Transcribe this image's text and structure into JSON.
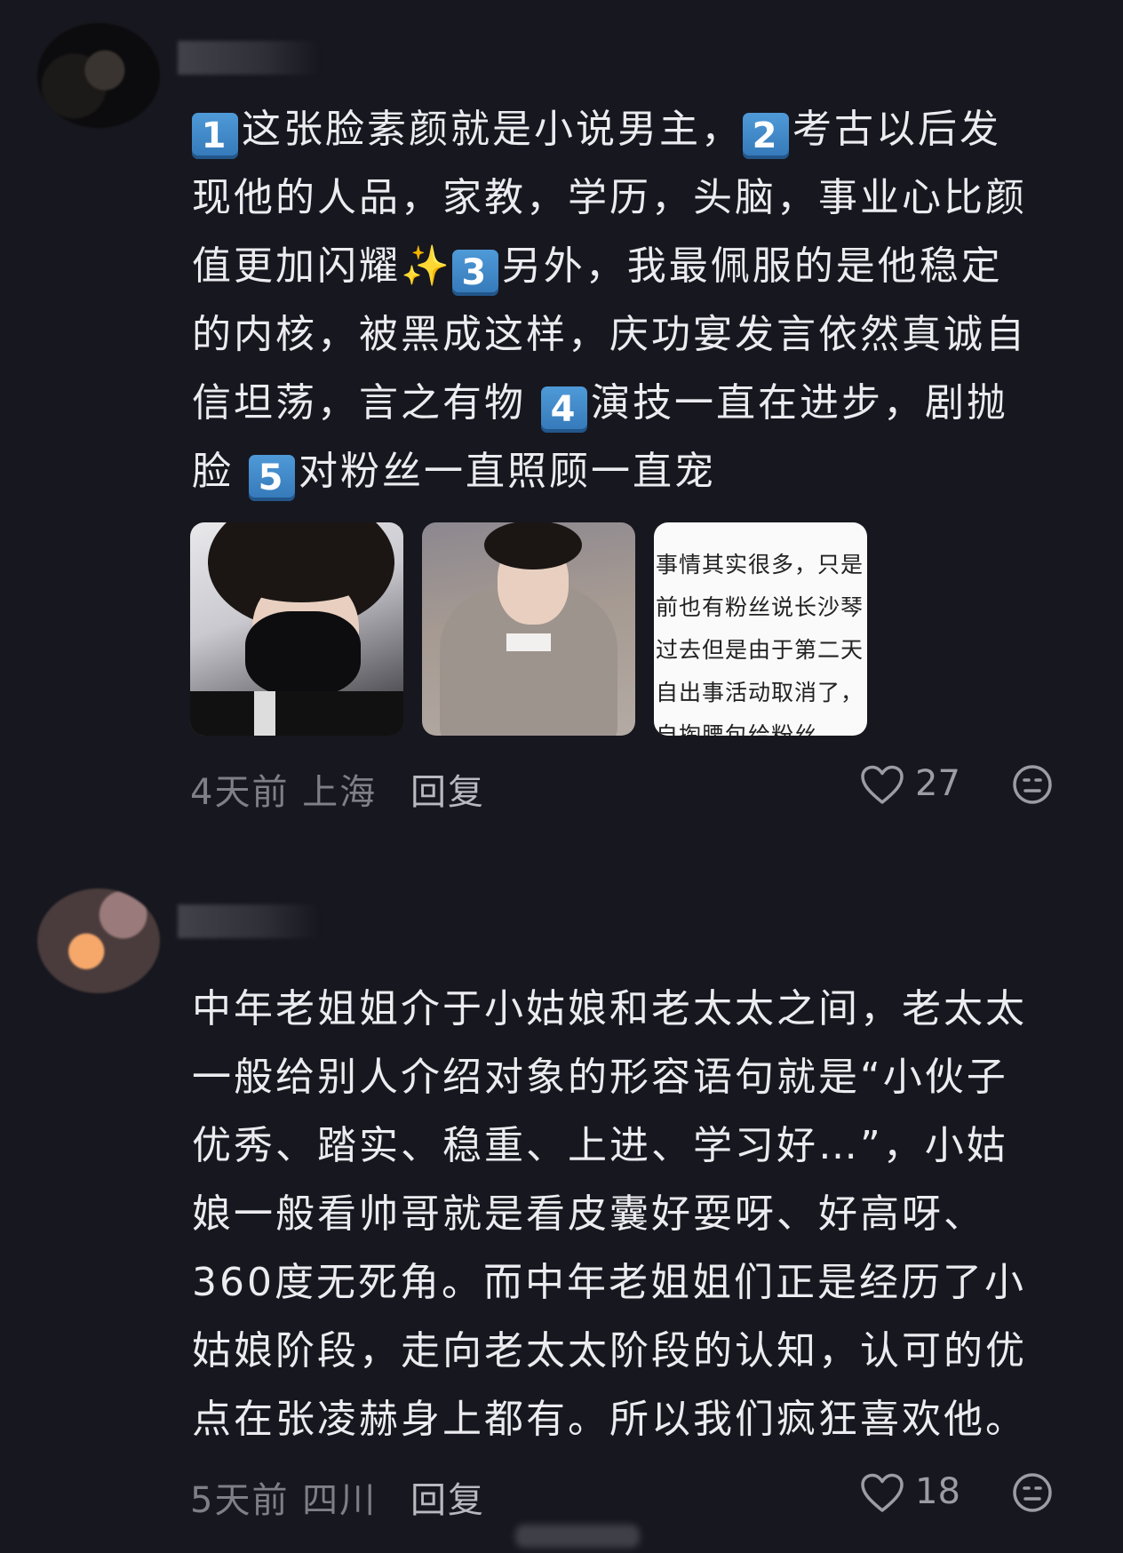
{
  "comments": [
    {
      "lines": [
        [
          {
            "k": "1"
          },
          "这张脸素颜就是小说男主，",
          {
            "k": "2"
          },
          "考古以后发"
        ],
        [
          "现他的人品，家教，学历，头脑，事业心比颜"
        ],
        [
          "值更加闪耀",
          {
            "s": "✨"
          },
          {
            "k": "3"
          },
          "另外，我最佩服的是他稳定"
        ],
        [
          "的内核，被黑成这样，庆功宴发言依然真诚自"
        ],
        [
          "信坦荡，言之有物 ",
          {
            "k": "4"
          },
          "演技一直在进步，剧抛"
        ],
        [
          "脸 ",
          {
            "k": "5"
          },
          "对粉丝一直照顾一直宠"
        ]
      ],
      "thumb_text": [
        "事情其实很多，只是",
        "前也有粉丝说长沙琴",
        "过去但是由于第二天",
        "自出事活动取消了，",
        "自掏腰包给粉丝"
      ],
      "time_location": "4天前 上海",
      "reply_label": "回复",
      "likes": "27"
    },
    {
      "lines": [
        [
          "中年老姐姐介于小姑娘和老太太之间，老太太"
        ],
        [
          "一般给别人介绍对象的形容语句就是“小伙子"
        ],
        [
          "优秀、踏实、稳重、上进、学习好…”，小姑"
        ],
        [
          "娘一般看帅哥就是看皮囊好耍呀、好高呀、"
        ],
        [
          "360度无死角。而中年老姐姐们正是经历了小"
        ],
        [
          "姑娘阶段，走向老太太阶段的认知，认可的优"
        ],
        [
          "点在张凌赫身上都有。所以我们疯狂喜欢他。"
        ]
      ],
      "time_location": "5天前 四川",
      "reply_label": "回复",
      "likes": "18"
    }
  ],
  "icons": {
    "like": "heart-outline-icon",
    "dislike": "neutral-face-icon",
    "number_badge": "keycap-digit-emoji",
    "sparkles": "sparkles-emoji"
  },
  "colors": {
    "background": "#17171f",
    "text": "#ececf0",
    "meta": "#7f7f88",
    "keycap": "#3f86c8"
  }
}
